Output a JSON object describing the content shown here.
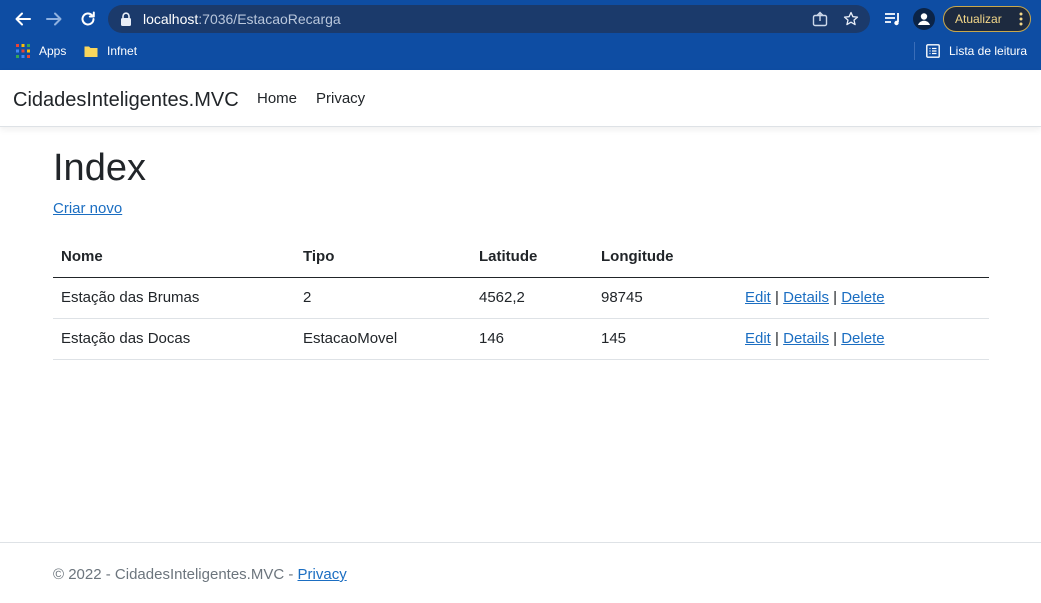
{
  "browser": {
    "url_host": "localhost",
    "url_rest": ":7036/EstacaoRecarga",
    "update_label": "Atualizar",
    "bookmarks": [
      {
        "label": "Apps",
        "icon": "apps-grid-icon"
      },
      {
        "label": "Infnet",
        "icon": "folder-icon"
      }
    ],
    "reading_list_label": "Lista de leitura",
    "colors": {
      "chrome": "#0e4da3",
      "omnibox": "#1b3a6b"
    }
  },
  "navbar": {
    "brand": "CidadesInteligentes.MVC",
    "links": [
      {
        "label": "Home"
      },
      {
        "label": "Privacy"
      }
    ]
  },
  "main": {
    "title": "Index",
    "create_link": "Criar novo",
    "table": {
      "headers": [
        "Nome",
        "Tipo",
        "Latitude",
        "Longitude"
      ],
      "rows": [
        {
          "nome": "Estação das Brumas",
          "tipo": "2",
          "latitude": "4562,2",
          "longitude": "98745"
        },
        {
          "nome": "Estação das Docas",
          "tipo": "EstacaoMovel",
          "latitude": "146",
          "longitude": "145"
        }
      ],
      "actions": {
        "edit": "Edit",
        "details": "Details",
        "delete": "Delete",
        "separator": "|"
      }
    },
    "link_color": "#1b6ec2"
  },
  "footer": {
    "text": "© 2022 - CidadesInteligentes.MVC -",
    "privacy_link": "Privacy"
  }
}
